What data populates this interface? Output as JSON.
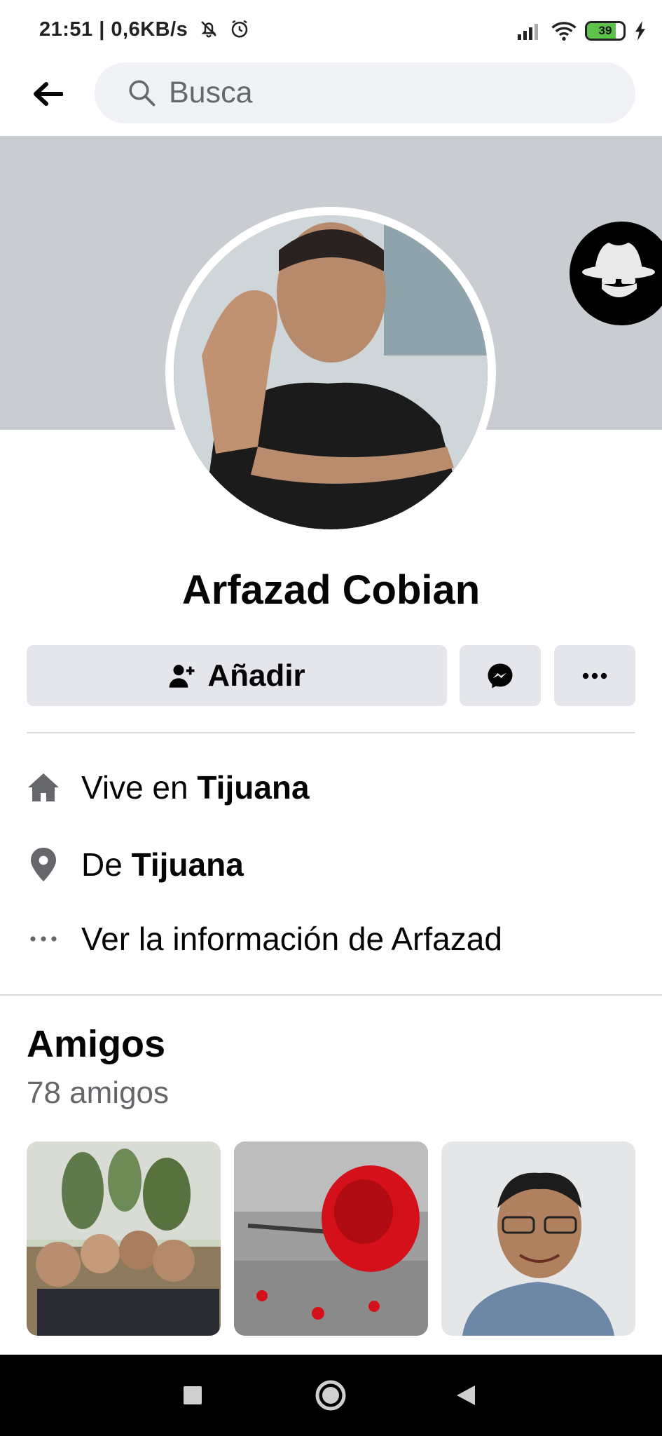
{
  "status_bar": {
    "time": "21:51 | 0,6KB/s",
    "battery_level": "39"
  },
  "header": {
    "search_placeholder": "Busca"
  },
  "profile": {
    "name": "Arfazad Cobian",
    "add_button_label": "Añadir"
  },
  "info": [
    {
      "icon": "home-icon",
      "prefix": "Vive en ",
      "value": "Tijuana"
    },
    {
      "icon": "location-pin-icon",
      "prefix": "De ",
      "value": "Tijuana"
    },
    {
      "icon": "more-dots-icon",
      "prefix": "Ver la información de Arfazad",
      "value": ""
    }
  ],
  "friends": {
    "title": "Amigos",
    "count": "78 amigos"
  },
  "colors": {
    "cover": "#c9ccd1",
    "button_bg": "#e4e6eb",
    "secondary_text": "#65676b",
    "battery_fill": "#5cc24a"
  }
}
